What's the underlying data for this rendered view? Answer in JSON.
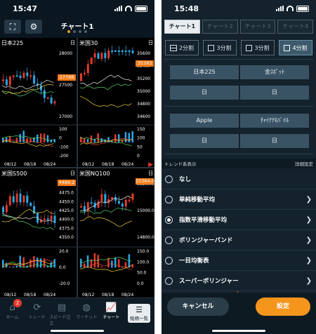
{
  "left": {
    "time": "15:47",
    "header": {
      "title": "チャート1",
      "page_dots": 4,
      "active_dot": 0
    },
    "panels": [
      {
        "name": "日本225",
        "interval": "日",
        "price_label": "27768",
        "y_ticks": [
          "28000",
          "27500",
          "27000"
        ],
        "osc_ticks": [
          "100",
          "0",
          "-100",
          "-200"
        ],
        "x_ticks": [
          "08/12",
          "08/18",
          "08/24"
        ]
      },
      {
        "name": "米国30",
        "interval": "日",
        "price_label": "35383",
        "y_ticks": [
          "35600",
          "35400",
          "35200",
          "35000",
          "34800",
          "34600"
        ],
        "osc_ticks": [
          "150",
          "100",
          "50",
          "0"
        ],
        "x_ticks": [
          "08/12",
          "08/18",
          "08/24"
        ]
      },
      {
        "name": "米国S500",
        "interval": "日",
        "price_label": "4489.2",
        "y_ticks": [
          "4500.0",
          "4475.0",
          "4450.0",
          "4425.0",
          "4400.0",
          "4375.0",
          "4350.0"
        ],
        "osc_ticks": [
          "20.0",
          "0.0",
          "-20.0"
        ],
        "x_ticks": [
          "08/12",
          "08/18",
          "08/24"
        ]
      },
      {
        "name": "米国NQ100",
        "interval": "日",
        "price_label": "15364.0",
        "y_ticks": [
          "15200.0",
          "15000.0",
          "14800.0"
        ],
        "osc_ticks": [
          "150.0",
          "100.0",
          "50.0",
          "0.0"
        ],
        "x_ticks": [
          "08/12",
          "08/18",
          "08/24"
        ]
      }
    ],
    "tabs": [
      {
        "label": "ホーム",
        "icon": "house-icon",
        "badge": "2"
      },
      {
        "label": "トレード",
        "icon": "cycle-icon"
      },
      {
        "label": "スピード注文",
        "icon": "speed-icon"
      },
      {
        "label": "マーケット",
        "icon": "globe-icon"
      },
      {
        "label": "チャート",
        "icon": "chart-icon"
      },
      {
        "label": "銘柄一覧",
        "icon": "list-icon"
      }
    ]
  },
  "right": {
    "time": "15:48",
    "chart_tabs": [
      "チャート1",
      "チャート2",
      "チャート3",
      "チャート4"
    ],
    "active_chart_tab": 0,
    "splits": [
      "2分割",
      "3分割",
      "3分割",
      "4分割"
    ],
    "active_split": 3,
    "slots": [
      {
        "symbol": "日本225",
        "interval": "日"
      },
      {
        "symbol": "金ｽﾎﾟｯﾄ",
        "interval": "日"
      },
      {
        "symbol": "Apple",
        "interval": "日"
      },
      {
        "symbol": "ﾁｬｲﾅﾃﾓﾊﾞｲﾙ",
        "interval": "日"
      }
    ],
    "trend_header": {
      "label": "トレンド系表示",
      "detail": "詳細設定"
    },
    "options": [
      {
        "label": "なし",
        "selected": false,
        "chevron": false
      },
      {
        "label": "単純移動平均",
        "selected": false,
        "chevron": true
      },
      {
        "label": "指数平滑移動平均",
        "selected": true,
        "chevron": true
      },
      {
        "label": "ボリンジャーバンド",
        "selected": false,
        "chevron": true
      },
      {
        "label": "一目均衡表",
        "selected": false,
        "chevron": true
      },
      {
        "label": "スーパーボリンジャー",
        "selected": false,
        "chevron": true
      }
    ],
    "cancel_label": "キャンセル",
    "ok_label": "設定"
  },
  "colors": {
    "up": "#e33a2c",
    "down": "#2aa7e6",
    "accent": "#f5951c",
    "price_tag": "#f57c1b"
  }
}
